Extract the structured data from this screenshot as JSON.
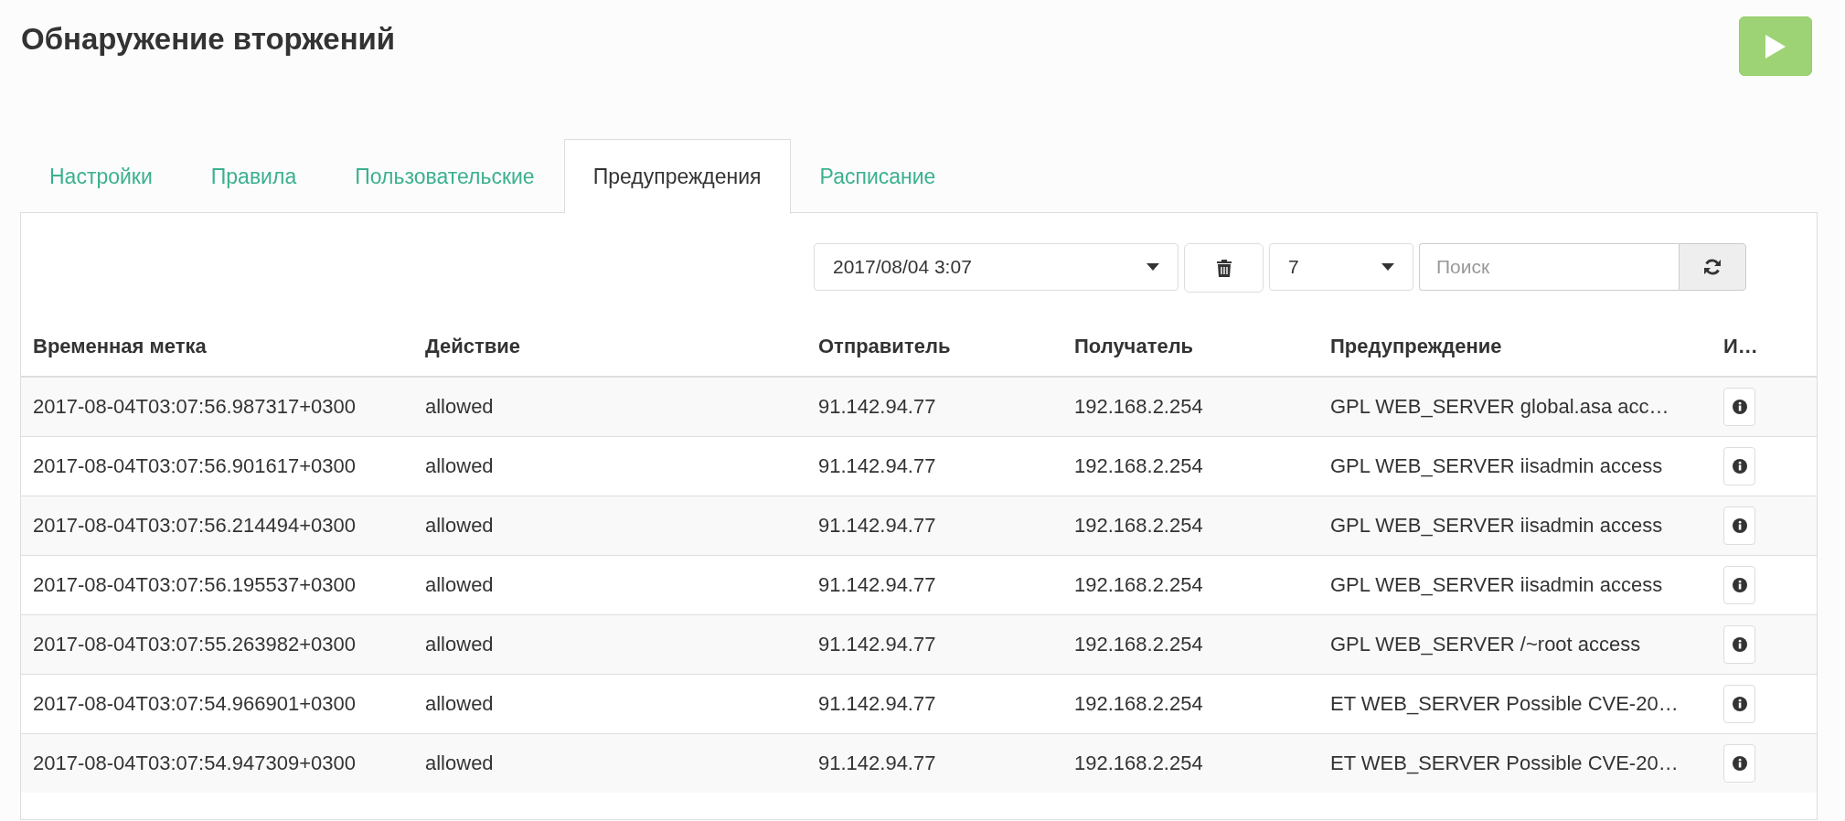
{
  "title": "Обнаружение вторжений",
  "tabs": [
    {
      "label": "Настройки",
      "selected": false
    },
    {
      "label": "Правила",
      "selected": false
    },
    {
      "label": "Пользовательские",
      "selected": false
    },
    {
      "label": "Предупреждения",
      "selected": true
    },
    {
      "label": "Расписание",
      "selected": false
    }
  ],
  "toolbar": {
    "date_select": "2017/08/04 3:07",
    "count_select": "7",
    "search": {
      "placeholder": "Поиск"
    }
  },
  "table": {
    "columns": [
      "Временная метка",
      "Действие",
      "Отправитель",
      "Получатель",
      "Предупреждение",
      "И…"
    ],
    "rows": [
      [
        "2017-08-04T03:07:56.987317+0300",
        "allowed",
        "91.142.94.77",
        "192.168.2.254",
        "GPL WEB_SERVER global.asa acc…"
      ],
      [
        "2017-08-04T03:07:56.901617+0300",
        "allowed",
        "91.142.94.77",
        "192.168.2.254",
        "GPL WEB_SERVER iisadmin access"
      ],
      [
        "2017-08-04T03:07:56.214494+0300",
        "allowed",
        "91.142.94.77",
        "192.168.2.254",
        "GPL WEB_SERVER iisadmin access"
      ],
      [
        "2017-08-04T03:07:56.195537+0300",
        "allowed",
        "91.142.94.77",
        "192.168.2.254",
        "GPL WEB_SERVER iisadmin access"
      ],
      [
        "2017-08-04T03:07:55.263982+0300",
        "allowed",
        "91.142.94.77",
        "192.168.2.254",
        "GPL WEB_SERVER /~root access"
      ],
      [
        "2017-08-04T03:07:54.966901+0300",
        "allowed",
        "91.142.94.77",
        "192.168.2.254",
        "ET WEB_SERVER Possible CVE-20…"
      ],
      [
        "2017-08-04T03:07:54.947309+0300",
        "allowed",
        "91.142.94.77",
        "192.168.2.254",
        "ET WEB_SERVER Possible CVE-20…"
      ]
    ]
  }
}
